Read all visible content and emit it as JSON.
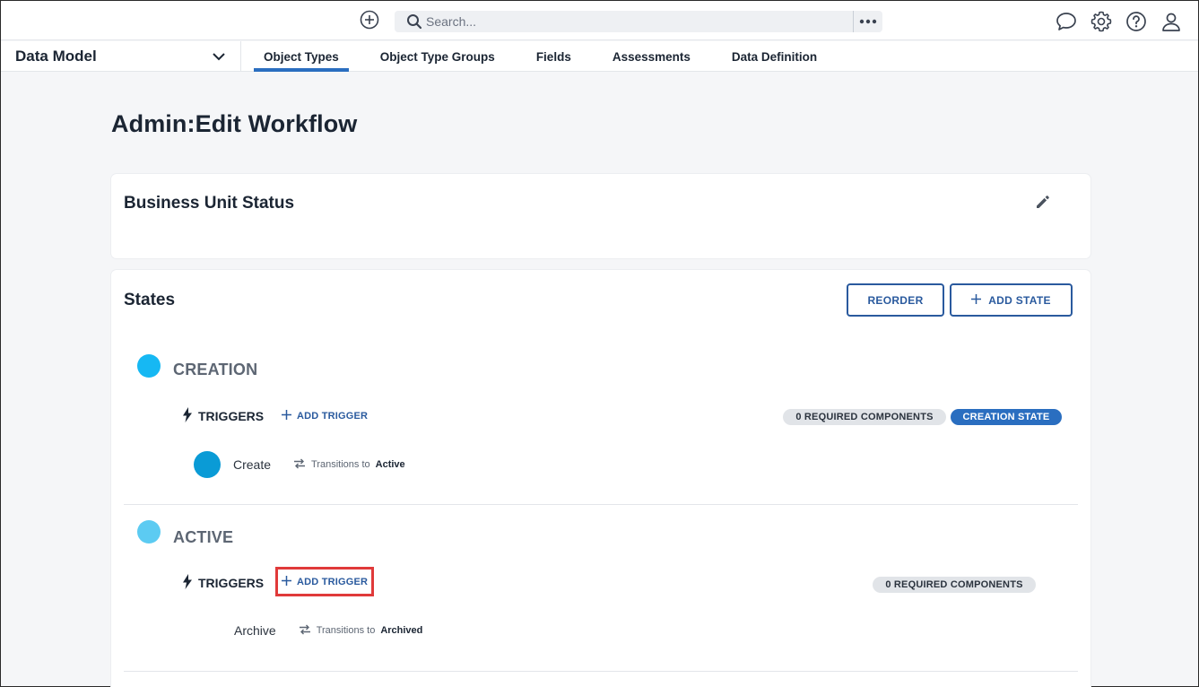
{
  "topbar": {
    "search_placeholder": "Search..."
  },
  "navbar": {
    "app_name": "Data Model",
    "tabs": [
      {
        "label": "Object Types",
        "active": true
      },
      {
        "label": "Object Type Groups",
        "active": false
      },
      {
        "label": "Fields",
        "active": false
      },
      {
        "label": "Assessments",
        "active": false
      },
      {
        "label": "Data Definition",
        "active": false
      }
    ]
  },
  "page": {
    "title_prefix": "Admin",
    "title_sep": ":",
    "title_main": "Edit Workflow"
  },
  "workflow": {
    "name": "Business Unit Status"
  },
  "states_section": {
    "title": "States",
    "reorder_label": "REORDER",
    "add_state_label": "ADD STATE",
    "states": [
      {
        "name": "CREATION",
        "color": "#16b8f3",
        "triggers_label": "TRIGGERS",
        "add_trigger_label": "ADD TRIGGER",
        "required_components": "0 REQUIRED COMPONENTS",
        "creation_badge": "CREATION STATE",
        "trigger": {
          "name": "Create",
          "transitions_text": "Transitions to",
          "target": "Active",
          "dot_color": "#0a9bd6"
        }
      },
      {
        "name": "ACTIVE",
        "color": "#5ccbf2",
        "triggers_label": "TRIGGERS",
        "add_trigger_label": "ADD TRIGGER",
        "required_components": "0 REQUIRED COMPONENTS",
        "trigger": {
          "name": "Archive",
          "transitions_text": "Transitions to",
          "target": "Archived"
        }
      }
    ]
  },
  "colors": {
    "accent": "#2a6ec0",
    "button_border": "#2a5a9e",
    "highlight": "#e03a3a"
  }
}
